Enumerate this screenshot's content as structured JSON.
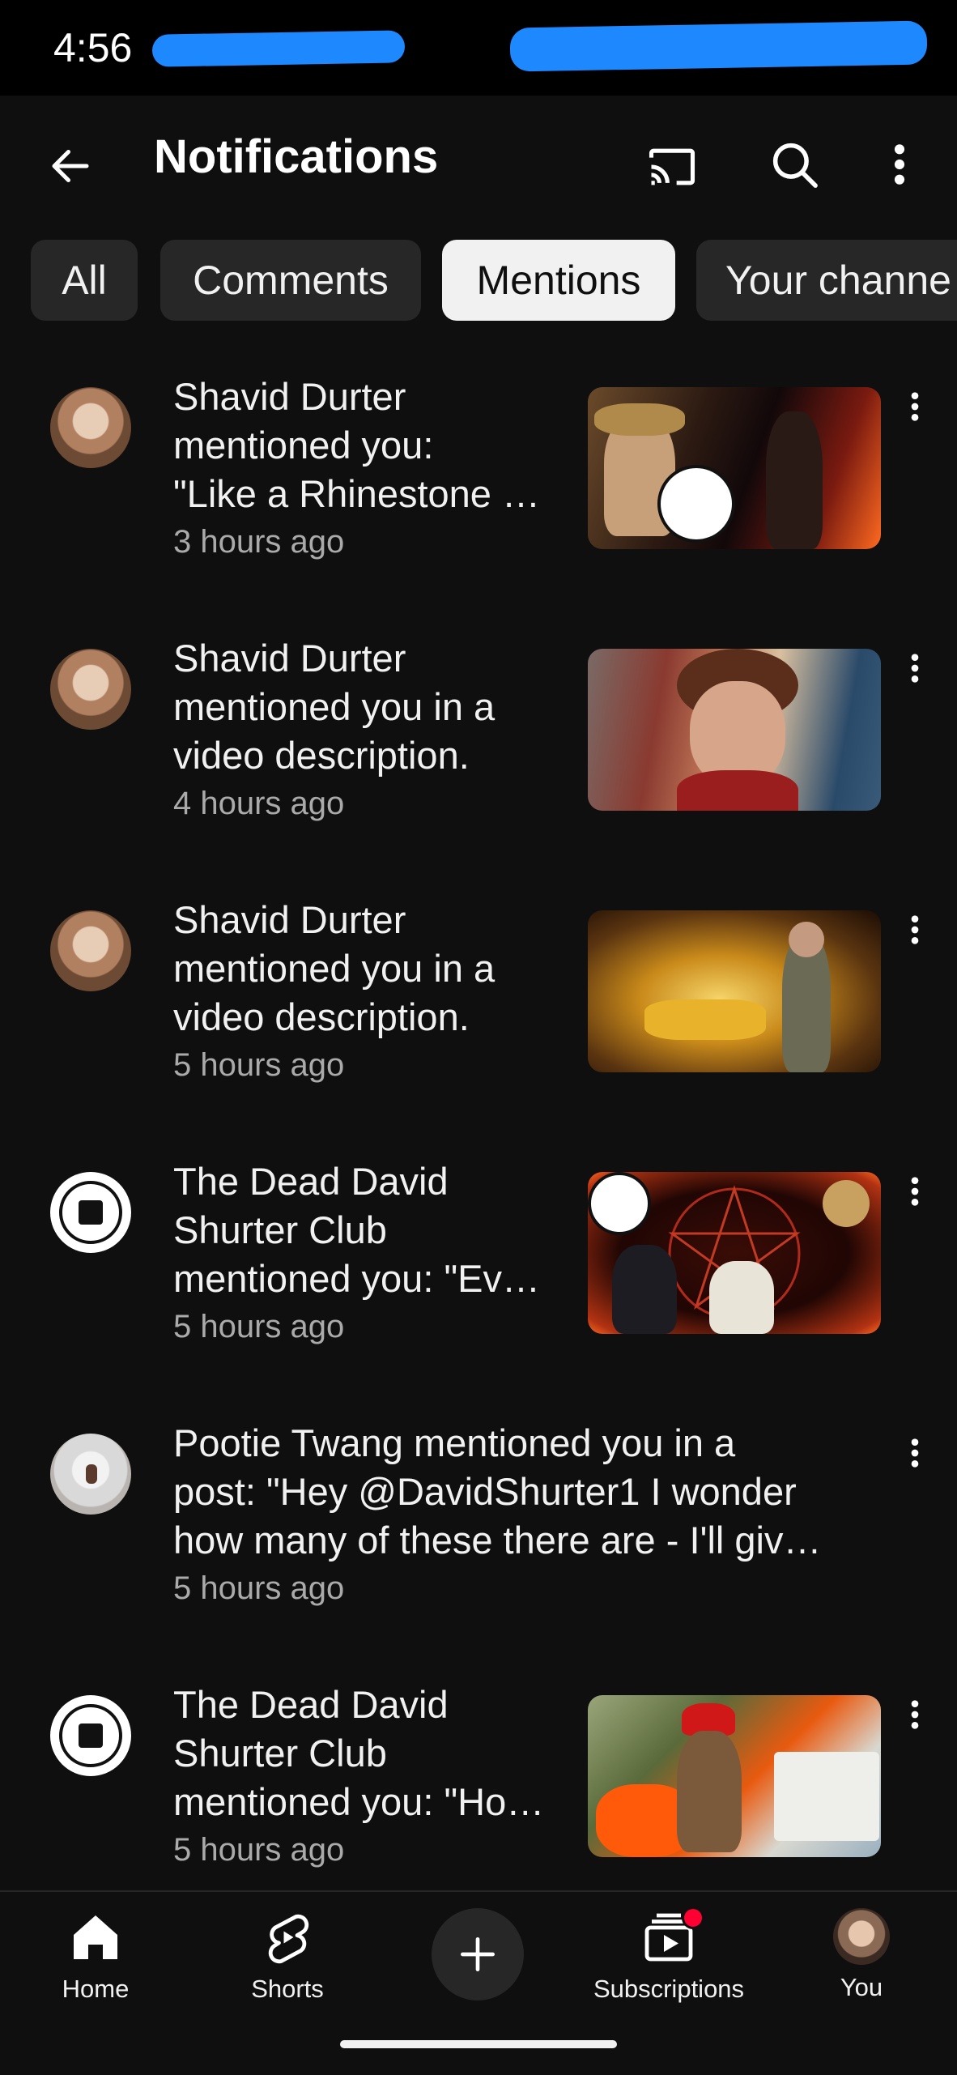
{
  "status_bar": {
    "time": "4:56"
  },
  "header": {
    "title": "Notifications",
    "back_icon": "arrow-left-icon",
    "cast_icon": "cast-icon",
    "search_icon": "search-icon",
    "more_icon": "more-vert-icon"
  },
  "chips": [
    {
      "label": "All",
      "active": false
    },
    {
      "label": "Comments",
      "active": false
    },
    {
      "label": "Mentions",
      "active": true
    },
    {
      "label": "Your channe",
      "active": false
    }
  ],
  "notifications": [
    {
      "line1": "Shavid Durter",
      "line2": "mentioned you:",
      "line3": "\"Like a Rhinestone …",
      "time": "3 hours ago"
    },
    {
      "line1": "Shavid Durter",
      "line2": "mentioned you in a",
      "line3": "video description.",
      "time": "4 hours ago"
    },
    {
      "line1": "Shavid Durter",
      "line2": "mentioned you in a",
      "line3": "video description.",
      "time": "5 hours ago"
    },
    {
      "line1": "The Dead David",
      "line2": "Shurter Club",
      "line3": "mentioned you: \"Ev…",
      "time": "5 hours ago"
    },
    {
      "line1": "Pootie Twang mentioned you in a",
      "line2": "post: \"Hey @DavidShurter1 I wonder",
      "line3": "how many of these there are - I'll giv…",
      "time": "5 hours ago"
    },
    {
      "line1": "The Dead David",
      "line2": "Shurter Club",
      "line3": "mentioned you: \"Ho…",
      "time": "5 hours ago"
    }
  ],
  "bottom_nav": {
    "home": "Home",
    "shorts": "Shorts",
    "create_icon": "plus-icon",
    "subscriptions": "Subscriptions",
    "you": "You"
  },
  "colors": {
    "background": "#0f0f0f",
    "chip": "#272727",
    "chip_active": "#f1f1f1",
    "text_secondary": "#aaaaaa",
    "accent_red": "#ff0033"
  }
}
